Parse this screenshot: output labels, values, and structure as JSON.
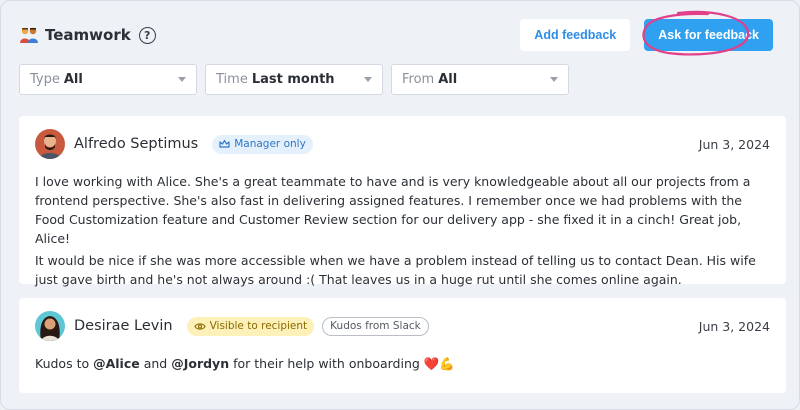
{
  "header": {
    "title": "Teamwork",
    "add_feedback": "Add feedback",
    "ask_feedback": "Ask for feedback"
  },
  "filters": [
    {
      "label": "Type",
      "value": "All"
    },
    {
      "label": "Time",
      "value": "Last month"
    },
    {
      "label": "From",
      "value": "All"
    }
  ],
  "feedback": [
    {
      "author": "Alfredo Septimus",
      "badge": "Manager only",
      "date": "Jun 3, 2024",
      "paragraphs": [
        "I love working with Alice. She's a great teammate to have and is very knowledgeable about all our projects from a frontend perspective. She's also fast in delivering assigned features. I remember once we had problems with the Food Customization feature and Customer Review section for our delivery app - she fixed it in a cinch! Great job, Alice!",
        "It would be nice if she was more accessible when we have a problem instead of telling us to contact Dean. His wife just gave birth and he's not always around :( That leaves us in a huge rut until she comes online again."
      ]
    },
    {
      "author": "Desirae Levin",
      "badge": "Visible to recipient",
      "source_badge": "Kudos from Slack",
      "date": "Jun 3, 2024",
      "text_prefix": "Kudos to ",
      "mention1": "@Alice",
      "text_mid": " and ",
      "mention2": "@Jordyn",
      "text_suffix": " for their help with onboarding ❤️💪"
    }
  ],
  "colors": {
    "accent": "#2fa1f0",
    "highlight_circle": "#e0418a"
  }
}
